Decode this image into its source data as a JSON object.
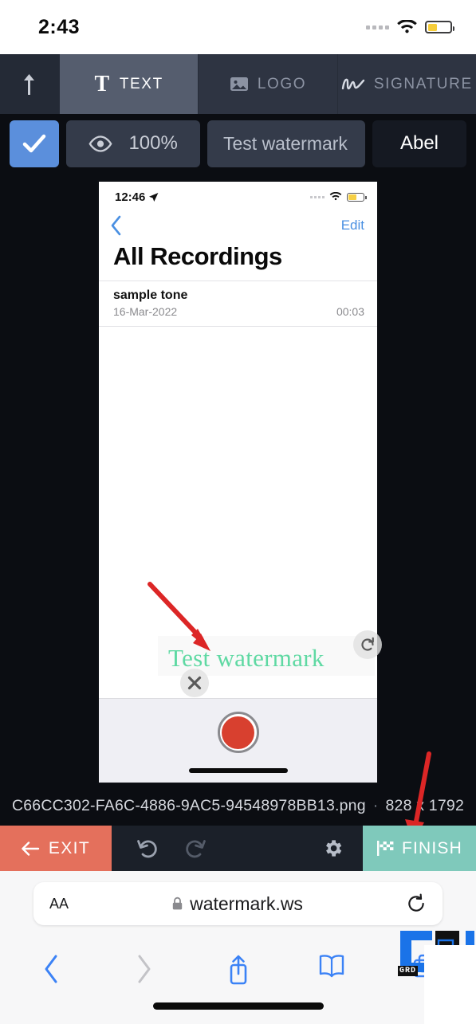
{
  "status_bar": {
    "time": "2:43",
    "signal_icon": "signal-dots-icon",
    "wifi_icon": "wifi-icon",
    "battery_icon": "battery-low-power-icon"
  },
  "editor": {
    "upload_tab": {
      "icon": "upload-arrow-icon",
      "label": ""
    },
    "tabs": [
      {
        "id": "text",
        "label": "TEXT",
        "icon": "text-t-icon",
        "active": true
      },
      {
        "id": "logo",
        "label": "LOGO",
        "icon": "image-icon",
        "active": false
      },
      {
        "id": "signature",
        "label": "SIGNATURE",
        "icon": "signature-icon",
        "active": false
      }
    ],
    "options": {
      "enabled_icon": "checkmark-icon",
      "enabled": true,
      "visibility_icon": "eye-icon",
      "opacity": "100%",
      "watermark_text": "Test watermark",
      "watermark_placeholder": "Test watermark",
      "font_name": "Abel"
    },
    "accent_checkbox": "#5b8fdc",
    "accent_exit": "#e4705c",
    "accent_finish": "#7fc9bb",
    "watermark_color": "#5fd9a3"
  },
  "canvas": {
    "watermark_overlay": "Test watermark",
    "delete_handle_icon": "close-x-icon",
    "rotate_handle_icon": "rotate-cw-icon",
    "preview": {
      "status_time": "12:46",
      "location_icon": "location-arrow-icon",
      "back_icon": "chevron-left-icon",
      "edit_label": "Edit",
      "title": "All Recordings",
      "rows": [
        {
          "name": "sample tone",
          "date": "16-Mar-2022",
          "duration": "00:03"
        }
      ],
      "record_button_icon": "record-circle-icon"
    }
  },
  "file_info": {
    "filename": "C66CC302-FA6C-4886-9AC5-94548978BB13.png",
    "separator": "·",
    "dimensions": "828 x 1792"
  },
  "action_bar": {
    "exit_label": "EXIT",
    "exit_icon": "arrow-left-icon",
    "undo_icon": "undo-icon",
    "redo_icon": "redo-icon",
    "settings_icon": "gear-icon",
    "finish_label": "FINISH",
    "finish_icon": "checkered-flag-icon"
  },
  "browser": {
    "text_size_label": "AA",
    "lock_icon": "lock-icon",
    "url": "watermark.ws",
    "reload_icon": "reload-icon",
    "back_icon": "chevron-left-icon",
    "forward_icon": "chevron-right-icon",
    "share_icon": "share-icon",
    "bookmarks_icon": "book-icon",
    "tabs_icon": "tabs-icon"
  },
  "corner_watermark": {
    "label": "GRD"
  },
  "annotations": [
    {
      "id": "arrow-to-watermark",
      "color": "#dc2626"
    },
    {
      "id": "arrow-to-finish",
      "color": "#dc2626"
    }
  ]
}
